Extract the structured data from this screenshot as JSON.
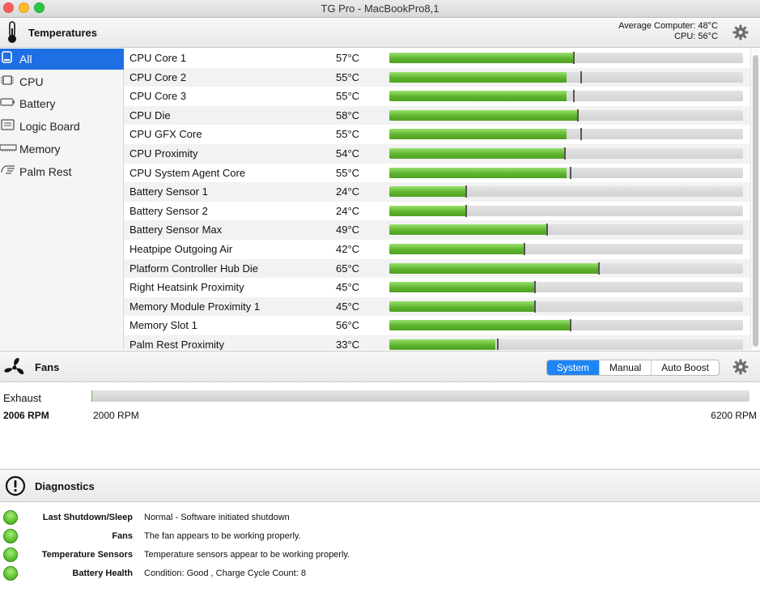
{
  "window": {
    "title": "TG Pro - MacBookPro8,1"
  },
  "temperatures": {
    "title": "Temperatures",
    "average_computer": "Average Computer:  48°C",
    "cpu_average": "CPU:  56°C",
    "sidebar": [
      {
        "label": "All",
        "icon": "all-icon",
        "selected": true
      },
      {
        "label": "CPU",
        "icon": "cpu-icon"
      },
      {
        "label": "Battery",
        "icon": "battery-icon"
      },
      {
        "label": "Logic Board",
        "icon": "logic-board-icon"
      },
      {
        "label": "Memory",
        "icon": "memory-icon"
      },
      {
        "label": "Palm Rest",
        "icon": "palm-rest-icon"
      }
    ],
    "sensors": [
      {
        "name": "CPU Core 1",
        "value": "57°C",
        "level": 0.52,
        "max": 0.52
      },
      {
        "name": "CPU Core 2",
        "value": "55°C",
        "level": 0.5,
        "max": 0.54
      },
      {
        "name": "CPU Core 3",
        "value": "55°C",
        "level": 0.5,
        "max": 0.52
      },
      {
        "name": "CPU Die",
        "value": "58°C",
        "level": 0.53,
        "max": 0.53
      },
      {
        "name": "CPU GFX Core",
        "value": "55°C",
        "level": 0.5,
        "max": 0.54
      },
      {
        "name": "CPU Proximity",
        "value": "54°C",
        "level": 0.495,
        "max": 0.495
      },
      {
        "name": "CPU System Agent Core",
        "value": "55°C",
        "level": 0.5,
        "max": 0.51
      },
      {
        "name": "Battery Sensor 1",
        "value": "24°C",
        "level": 0.215,
        "max": 0.215
      },
      {
        "name": "Battery Sensor 2",
        "value": "24°C",
        "level": 0.215,
        "max": 0.215
      },
      {
        "name": "Battery Sensor Max",
        "value": "49°C",
        "level": 0.445,
        "max": 0.445
      },
      {
        "name": "Heatpipe Outgoing Air",
        "value": "42°C",
        "level": 0.38,
        "max": 0.38
      },
      {
        "name": "Platform Controller Hub Die",
        "value": "65°C",
        "level": 0.59,
        "max": 0.59
      },
      {
        "name": "Right Heatsink Proximity",
        "value": "45°C",
        "level": 0.41,
        "max": 0.41
      },
      {
        "name": "Memory Module Proximity 1",
        "value": "45°C",
        "level": 0.41,
        "max": 0.41
      },
      {
        "name": "Memory Slot 1",
        "value": "56°C",
        "level": 0.51,
        "max": 0.51
      },
      {
        "name": "Palm Rest Proximity",
        "value": "33°C",
        "level": 0.3,
        "max": 0.305
      }
    ]
  },
  "fans": {
    "title": "Fans",
    "modes": [
      "System",
      "Manual",
      "Auto Boost"
    ],
    "active_mode": "System",
    "fan": {
      "name": "Exhaust",
      "rpm": "2006 RPM",
      "min_label": "2000 RPM",
      "max_label": "6200 RPM",
      "level": 0.0014
    }
  },
  "diagnostics": {
    "title": "Diagnostics",
    "items": [
      {
        "label": "Last Shutdown/Sleep",
        "text": "Normal - Software initiated shutdown",
        "status": "green"
      },
      {
        "label": "Fans",
        "text": "The fan appears to be working properly.",
        "status": "green"
      },
      {
        "label": "Temperature Sensors",
        "text": "Temperature sensors appear to be working properly.",
        "status": "green"
      },
      {
        "label": "Battery Health",
        "text": "Condition: Good , Charge Cycle Count: 8",
        "status": "green"
      }
    ]
  },
  "colors": {
    "accent": "#1e6fe3",
    "bar_green": "#5fb52e",
    "status_ok": "#5cc22e"
  }
}
